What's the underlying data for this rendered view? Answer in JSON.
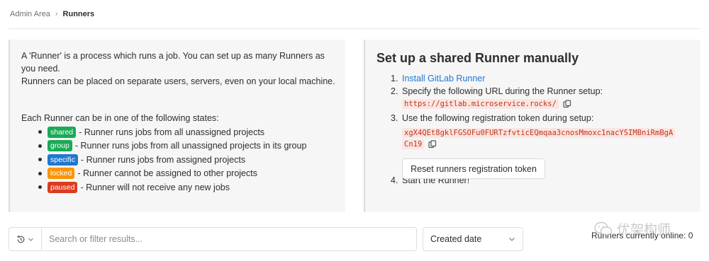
{
  "breadcrumb": {
    "parent": "Admin Area",
    "separator": "›",
    "current": "Runners"
  },
  "intro": {
    "line1": "A 'Runner' is a process which runs a job. You can set up as many Runners as you need.",
    "line2": "Runners can be placed on separate users, servers, even on your local machine.",
    "states_title": "Each Runner can be in one of the following states:"
  },
  "states": [
    {
      "badge": "shared",
      "color": "#1aaa55",
      "text": "- Runner runs jobs from all unassigned projects"
    },
    {
      "badge": "group",
      "color": "#1aaa55",
      "text": "- Runner runs jobs from all unassigned projects in its group"
    },
    {
      "badge": "specific",
      "color": "#1f78d1",
      "text": "- Runner runs jobs from assigned projects"
    },
    {
      "badge": "locked",
      "color": "#fc9403",
      "text": "- Runner cannot be assigned to other projects"
    },
    {
      "badge": "paused",
      "color": "#db3b21",
      "text": "- Runner will not receive any new jobs"
    }
  ],
  "setup": {
    "title": "Set up a shared Runner manually",
    "step1_link": "Install GitLab Runner",
    "step2_text": "Specify the following URL during the Runner setup:",
    "url": "https://gitlab.microservice.rocks/",
    "step3_text": "Use the following registration token during setup:",
    "token_part1": "xgX4QEt8gklFGSOFu0FURTzfvticEQmqaa3cnosMmoxc1nacYSIMBniRmBgA",
    "token_part2": "Cn19",
    "reset_button": "Reset runners registration token",
    "step4_text": "Start the Runner!"
  },
  "filter": {
    "placeholder": "Search or filter results...",
    "sort_value": "Created date"
  },
  "status": {
    "online_text": "Runners currently online: 0"
  },
  "watermark": {
    "text": "优架构师"
  },
  "icons": {
    "copy": "copy-icon",
    "history": "history-icon",
    "chevron": "chevron-down-icon"
  }
}
